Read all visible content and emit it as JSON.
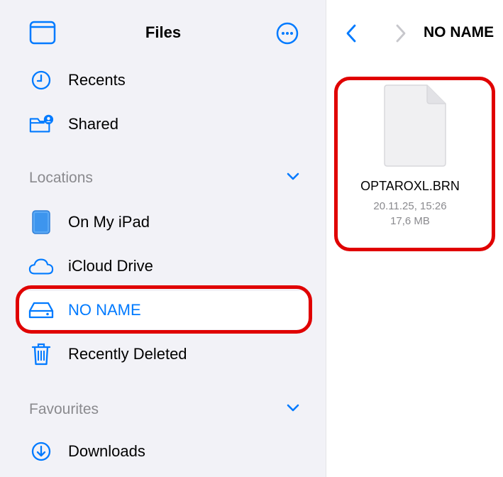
{
  "sidebar": {
    "title": "Files",
    "favourites_items": [
      {
        "label": "Recents",
        "icon": "clock-icon"
      },
      {
        "label": "Shared",
        "icon": "shared-folder-icon"
      }
    ],
    "locations": {
      "heading": "Locations",
      "items": [
        {
          "label": "On My iPad",
          "icon": "ipad-icon"
        },
        {
          "label": "iCloud Drive",
          "icon": "cloud-icon"
        },
        {
          "label": "NO NAME",
          "icon": "drive-icon",
          "selected": true
        },
        {
          "label": "Recently Deleted",
          "icon": "trash-icon"
        }
      ]
    },
    "favourites": {
      "heading": "Favourites",
      "items": [
        {
          "label": "Downloads",
          "icon": "download-icon"
        }
      ]
    }
  },
  "main": {
    "title": "NO NAME",
    "files": [
      {
        "name": "OPTAROXL.BRN",
        "date": "20.11.25, 15:26",
        "size": "17,6 MB"
      }
    ]
  },
  "colors": {
    "accent": "#007aff",
    "highlight": "#e00000",
    "sidebar_bg": "#f2f2f7",
    "secondary_text": "#8a8a8e"
  }
}
